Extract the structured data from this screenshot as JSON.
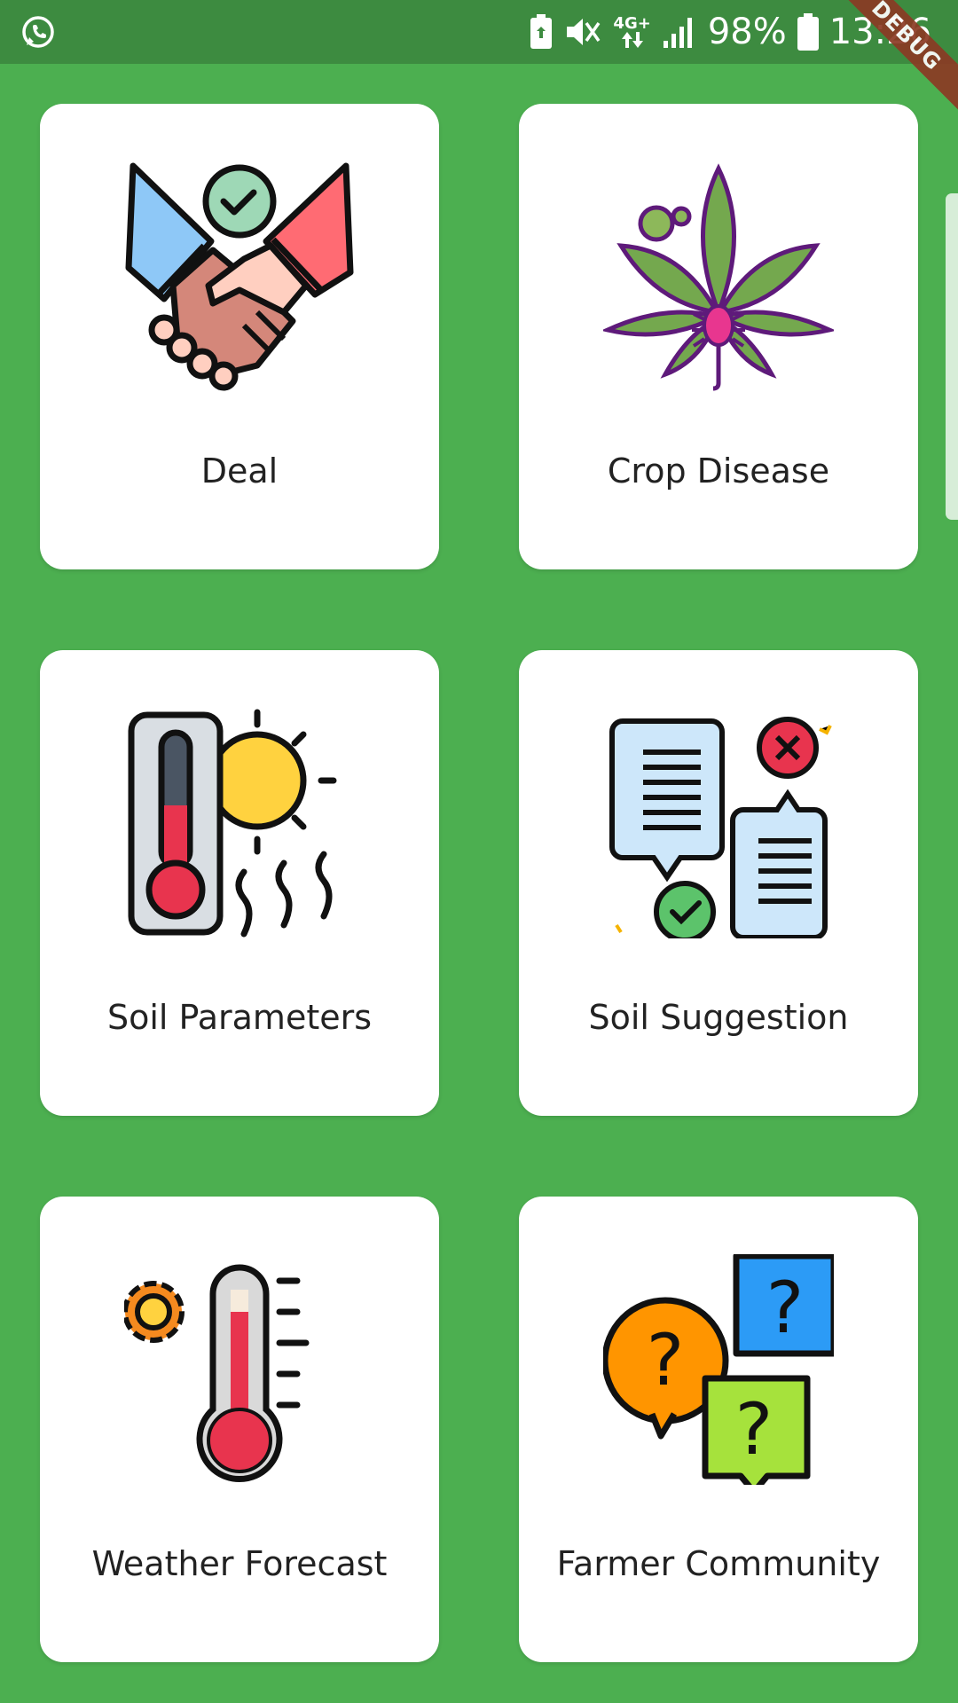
{
  "status_bar": {
    "battery_percent": "98%",
    "time": "13:26",
    "network_type": "4G+",
    "left_icon": "whatsapp-icon",
    "icons": [
      "battery-saver-icon",
      "mute-vibrate-icon",
      "data-arrows-icon",
      "signal-icon",
      "battery-icon"
    ],
    "debug_label": "DEBUG"
  },
  "menu": {
    "items": [
      {
        "label": "Deal",
        "icon": "handshake-icon"
      },
      {
        "label": "Crop Disease",
        "icon": "diseased-leaf-icon"
      },
      {
        "label": "Soil Parameters",
        "icon": "thermometer-sun-icon"
      },
      {
        "label": "Soil Suggestion",
        "icon": "suggestion-documents-icon"
      },
      {
        "label": "Weather Forecast",
        "icon": "weather-thermometer-icon"
      },
      {
        "label": "Farmer Community",
        "icon": "question-bubbles-icon"
      }
    ]
  },
  "colors": {
    "background": "#4CAF50",
    "status_bar": "#3D8B40",
    "card": "#FFFFFF",
    "debug_banner": "#8B3A24"
  }
}
